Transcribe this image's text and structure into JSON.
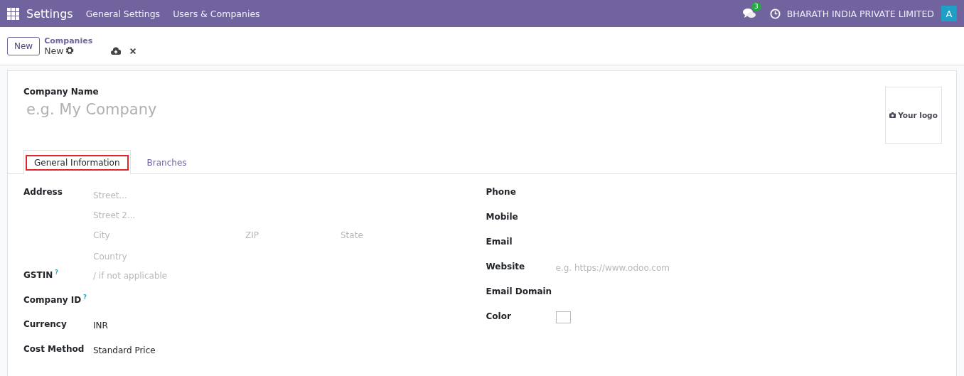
{
  "navbar": {
    "app_name": "Settings",
    "menu": [
      "General Settings",
      "Users & Companies"
    ],
    "messages_count": "3",
    "company": "BHARATH INDIA PRIVATE LIMITED",
    "avatar": "A"
  },
  "control_panel": {
    "new_button": "New",
    "breadcrumb": "Companies",
    "record": "New"
  },
  "form": {
    "name_label": "Company Name",
    "name_placeholder": "e.g. My Company",
    "logo": "Your logo",
    "tabs": [
      {
        "label": "General Information",
        "selected": true,
        "annotated": true
      },
      {
        "label": "Branches",
        "selected": false,
        "annotated": false
      }
    ],
    "address": {
      "label": "Address",
      "street_placeholder": "Street...",
      "street2_placeholder": "Street 2...",
      "city_placeholder": "City",
      "zip_placeholder": "ZIP",
      "state_placeholder": "State",
      "country_placeholder": "Country"
    },
    "left_fields": [
      {
        "kind": "text",
        "label": "GSTIN",
        "help": "?",
        "placeholder": "/ if not applicable"
      },
      {
        "kind": "text",
        "label": "Company ID",
        "help": "?"
      },
      {
        "kind": "text",
        "label": "Currency",
        "value": "INR"
      },
      {
        "kind": "text",
        "label": "Cost Method",
        "value": "Standard Price"
      }
    ],
    "right_fields": [
      {
        "kind": "text",
        "label": "Phone"
      },
      {
        "kind": "text",
        "label": "Mobile"
      },
      {
        "kind": "text",
        "label": "Email"
      },
      {
        "kind": "text",
        "label": "Website",
        "placeholder": "e.g. https://www.odoo.com"
      },
      {
        "kind": "text",
        "label": "Email Domain"
      },
      {
        "kind": "color",
        "label": "Color"
      }
    ]
  }
}
